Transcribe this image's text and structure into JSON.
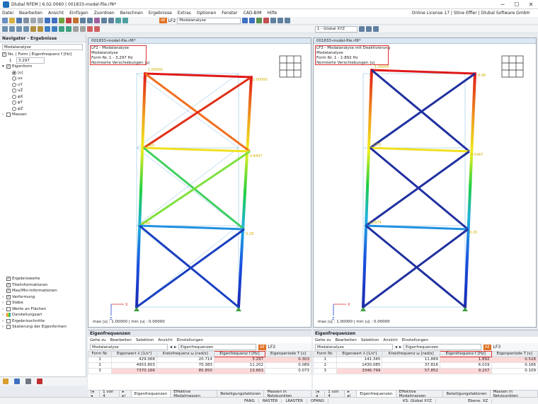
{
  "app": {
    "title": "Dlubal RFEM | 6.02.0060 | 001833-model-file.rf6*",
    "license": "Online License 17 | Stine Effler | Dlubal Software GmbH"
  },
  "menu": [
    "Datei",
    "Bearbeiten",
    "Ansicht",
    "Einfügen",
    "Zuordnen",
    "Berechnen",
    "Ergebnisse",
    "Extras",
    "Optionen",
    "Fenster",
    "CAD-BIM",
    "Hilfe"
  ],
  "toolbar": {
    "loadcase_tag": "AE",
    "loadcase": "LF2",
    "analysis": "Modalanalyse",
    "coord": "1 - Global XYZ"
  },
  "navigator": {
    "title": "Navigator - Ergebnisse",
    "combo": "Modalanalyse",
    "freq_label": "No. | Form | Eigenfrequenz f [Hz]",
    "freq_no": "1",
    "freq_value": "3.297",
    "eigenform": "Eigenform",
    "components": [
      "|u|",
      "ux",
      "uY",
      "uZ",
      "φX",
      "φY",
      "φZ"
    ],
    "massen": "Massen",
    "bottom": [
      "Ergebniswerte",
      "Titelinformationen",
      "Max/Min-Informationen",
      "Verformung",
      "Stäbe",
      "Werte an Flächen",
      "Darstellungsart",
      "Ergebnisschnitte",
      "Skalierung der Eigenformen"
    ]
  },
  "view_left": {
    "tab": "001833-model-file.rf6*",
    "line1": "LF2 - Modalanalyse",
    "line2": "Modalanalyse",
    "line3": "Form Nr. 1 - 3.297 Hz",
    "line4": "Normierte Verschiebungen |u|",
    "maxmin": "max |u| : 1.00000 | min |u| : 0.00000",
    "labels": {
      "a": "1.00000",
      "b": "1.00000",
      "c": "0.65",
      "d": "0.6447",
      "e": "0.40",
      "f": "0.28"
    }
  },
  "view_right": {
    "tab": "001833-model-file.rf6*",
    "line1": "LF3 - Modalanalyse mit Deaktivierung",
    "line2": "Modalanalyse",
    "line3": "Form Nr. 1 - 1.892 Hz",
    "line4": "Normierte Verschiebungen |u|",
    "maxmin": "max |u| : 1.00000 | min |u| : 0.00000",
    "labels": {
      "a": "1.00000",
      "b": "0.96",
      "c": "0.55",
      "d": "0.5467",
      "e": "0.2974",
      "f": "0.20"
    }
  },
  "panel_left": {
    "title": "Eigenfrequenzen",
    "menu": [
      "Gehe zu",
      "Bearbeiten",
      "Selektion",
      "Ansicht",
      "Einstellungen"
    ],
    "combo1": "Modalanalyse",
    "combo2": "Eigenfrequenzen",
    "tag": "AE",
    "lc": "LF2",
    "headers": [
      "Form Nr.",
      "Eigenwert λ [1/s²]",
      "Kreisfrequenz ω [rad/s]",
      "Eigenfrequenz f [Hz]",
      "Eigenperiode T [s]"
    ],
    "rows": [
      [
        "1",
        "429.068",
        "20.714",
        "3.297",
        "0.303"
      ],
      [
        "2",
        "4953.803",
        "70.383",
        "11.202",
        "0.089"
      ],
      [
        "3",
        "7370.166",
        "85.850",
        "13.663",
        "0.073"
      ]
    ],
    "page": "1 von 4",
    "tabs": [
      "Eigenfrequenzen",
      "Effektive Modalmassen",
      "Beteiligungsfaktoren",
      "Massen in Netzpunkten"
    ]
  },
  "panel_right": {
    "title": "Eigenfrequenzen",
    "menu": [
      "Gehe zu",
      "Bearbeiten",
      "Selektion",
      "Ansicht",
      "Einstellungen"
    ],
    "combo1": "Modalanalyse",
    "combo2": "Eigenfrequenzen",
    "tag": "AE",
    "lc": "LF3",
    "headers": [
      "Form Nr.",
      "Eigenwert λ [1/s²]",
      "Kreisfrequenz ω [rad/s]",
      "Eigenfrequenz f [Hz]",
      "Eigenperiode T [s]"
    ],
    "rows": [
      [
        "1",
        "141.345",
        "11.889",
        "1.892",
        "0.528"
      ],
      [
        "2",
        "1430.085",
        "37.816",
        "6.019",
        "0.166"
      ],
      [
        "3",
        "3346.799",
        "57.852",
        "9.207",
        "0.109"
      ]
    ],
    "page": "1 von 4",
    "tabs": [
      "Eigenfrequenzen",
      "Effektive Modalmassen",
      "Beteiligungsfaktoren",
      "Massen in Netzpunkten"
    ]
  },
  "status": [
    "FANG",
    "RASTER",
    "LRASTER",
    "OFANG",
    "KS: Global XYZ",
    "Ebene: XZ"
  ]
}
